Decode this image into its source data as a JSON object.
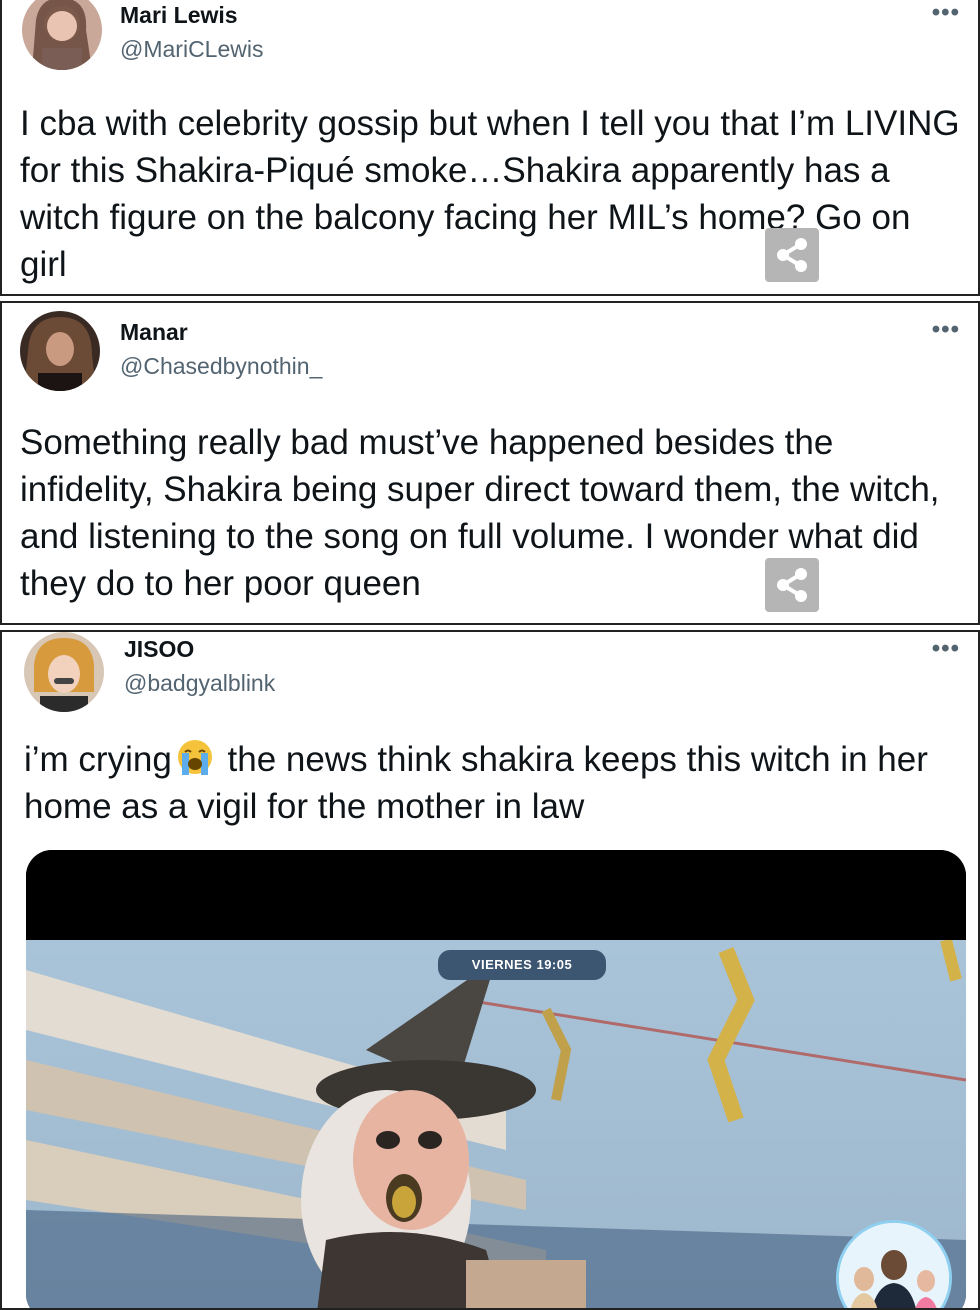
{
  "tweets": [
    {
      "name": "Mari Lewis",
      "handle": "@MariCLewis",
      "more_icon": "more-icon",
      "text": "I cba with celebrity gossip but when I tell you that I’m LIVING for this Shakira-Piqué smoke…Shakira apparently has a witch figure on the balcony facing her MIL’s home? Go on girl"
    },
    {
      "name": "Manar",
      "handle": "@Chasedbynothin_",
      "more_icon": "more-icon",
      "text": "Something really bad must’ve happened besides the infidelity, Shakira being super direct toward them, the witch, and listening to the song on full volume. I wonder what did they do to her poor queen"
    },
    {
      "name": "JISOO",
      "handle": "@badgyalblink",
      "more_icon": "more-icon",
      "text_before_emoji": "i’m crying",
      "emoji": "loudly-crying-face-emoji",
      "text_after_emoji": " the news think shakira keeps this witch in her home as a vigil for the mother in law",
      "media": {
        "badge": "VIERNES 19:05"
      }
    }
  ],
  "share_icon": "share-icon",
  "colors": {
    "text": "#0f1419",
    "handle": "#536471",
    "share_bg": "#b5b5b5",
    "badge_bg": "#3c5570"
  }
}
